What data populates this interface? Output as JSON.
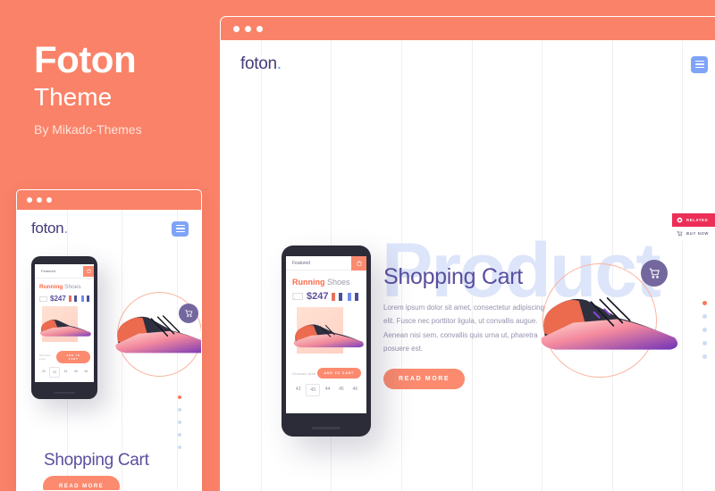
{
  "promo": {
    "title": "Foton",
    "subtitle": "Theme",
    "author": "By Mikado-Themes"
  },
  "colors": {
    "coral": "#fa8268",
    "purple": "#5a4f9e",
    "blue": "#7fa4f7",
    "watermark_blue": "#dde5fa",
    "badge_red": "#ec2f57",
    "cart_purple": "#74679e"
  },
  "browser": {
    "traffic_lights": [
      "dot-1",
      "dot-2",
      "dot-3"
    ],
    "logo": "foton",
    "logo_period": ".",
    "menu_icon": "hamburger-menu-icon"
  },
  "hero": {
    "watermark": "Product",
    "heading": "Shopping Cart",
    "paragraph": "Lorem ipsum dolor sit amet, consectetur adipiscing elit. Fusce nec porttitor ligula, ut convallis augue. Aenean nisi sem, convallis quis urna ut, pharetra posuere est.",
    "cta_label": "READ MORE"
  },
  "phone": {
    "header_label": "Featured",
    "cart_icon": "shopping-bag-icon",
    "product_brand": "Running",
    "product_type": "Shoes",
    "price": "$247",
    "stepper": "- +",
    "swatches": [
      "#e8705a",
      "#4a4f9e",
      "#6f8cf0",
      "#4a4f9e"
    ],
    "choose_label": "Choose size",
    "add_label": "ADD TO CART",
    "sizes": [
      "43",
      "43",
      "44",
      "45",
      "46"
    ],
    "selected_size_index": 1
  },
  "badges": [
    {
      "label": "RELATED",
      "icon": "record-circle-icon",
      "style": "related"
    },
    {
      "label": "BUY NOW",
      "icon": "cart-icon",
      "style": "buy"
    }
  ],
  "slider": {
    "dots": [
      true,
      false,
      false,
      false,
      false
    ]
  },
  "floating_cart": {
    "icon": "shopping-cart-icon"
  }
}
